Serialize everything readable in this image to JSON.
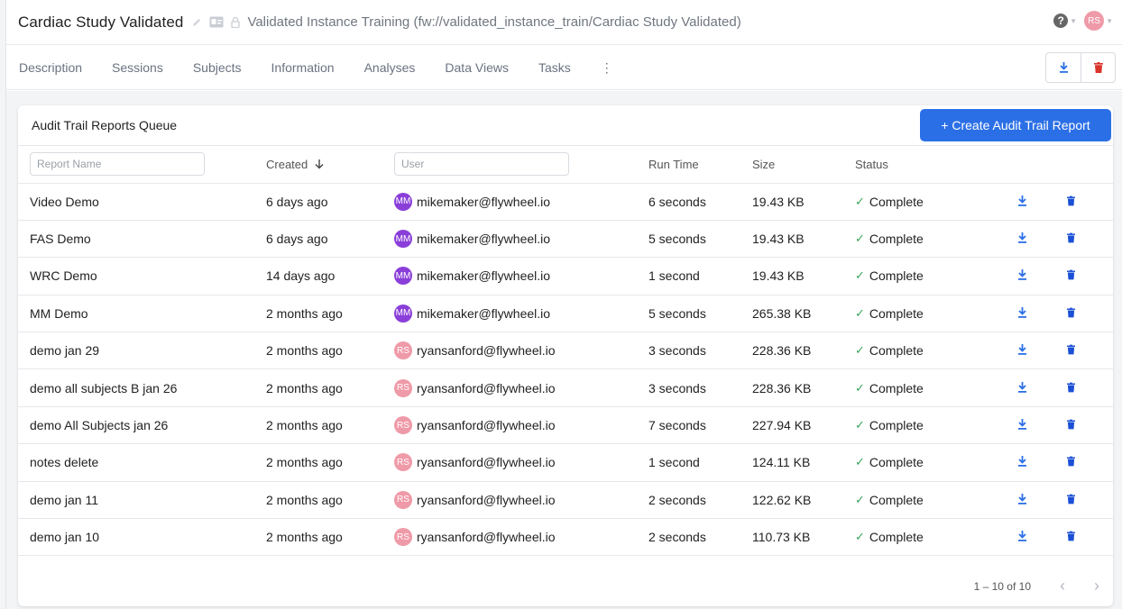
{
  "header": {
    "title": "Cardiac Study Validated",
    "path": "Validated Instance Training (fw://validated_instance_train/Cardiac Study Validated)",
    "help_icon": "?",
    "user_initials": "RS"
  },
  "tabs": [
    {
      "label": "Description"
    },
    {
      "label": "Sessions"
    },
    {
      "label": "Subjects"
    },
    {
      "label": "Information"
    },
    {
      "label": "Analyses"
    },
    {
      "label": "Data Views"
    },
    {
      "label": "Tasks"
    }
  ],
  "card": {
    "title": "Audit Trail Reports Queue",
    "create_label": "+ Create Audit Trail Report"
  },
  "table": {
    "report_placeholder": "Report Name",
    "user_placeholder": "User",
    "col_created": "Created",
    "col_runtime": "Run Time",
    "col_size": "Size",
    "col_status": "Status",
    "rows": [
      {
        "name": "Video Demo",
        "created": "6 days ago",
        "initials": "MM",
        "avatar_color": "#8a3fd9",
        "user": "mikemaker@flywheel.io",
        "runtime": "6 seconds",
        "size": "19.43 KB",
        "status": "Complete"
      },
      {
        "name": "FAS Demo",
        "created": "6 days ago",
        "initials": "MM",
        "avatar_color": "#8a3fd9",
        "user": "mikemaker@flywheel.io",
        "runtime": "5 seconds",
        "size": "19.43 KB",
        "status": "Complete"
      },
      {
        "name": "WRC Demo",
        "created": "14 days ago",
        "initials": "MM",
        "avatar_color": "#8a3fd9",
        "user": "mikemaker@flywheel.io",
        "runtime": "1 second",
        "size": "19.43 KB",
        "status": "Complete"
      },
      {
        "name": "MM Demo",
        "created": "2 months ago",
        "initials": "MM",
        "avatar_color": "#8a3fd9",
        "user": "mikemaker@flywheel.io",
        "runtime": "5 seconds",
        "size": "265.38 KB",
        "status": "Complete"
      },
      {
        "name": "demo jan 29",
        "created": "2 months ago",
        "initials": "RS",
        "avatar_color": "#ef9aa8",
        "user": "ryansanford@flywheel.io",
        "runtime": "3 seconds",
        "size": "228.36 KB",
        "status": "Complete"
      },
      {
        "name": "demo all subjects B jan 26",
        "created": "2 months ago",
        "initials": "RS",
        "avatar_color": "#ef9aa8",
        "user": "ryansanford@flywheel.io",
        "runtime": "3 seconds",
        "size": "228.36 KB",
        "status": "Complete"
      },
      {
        "name": "demo All Subjects jan 26",
        "created": "2 months ago",
        "initials": "RS",
        "avatar_color": "#ef9aa8",
        "user": "ryansanford@flywheel.io",
        "runtime": "7 seconds",
        "size": "227.94 KB",
        "status": "Complete"
      },
      {
        "name": "notes delete",
        "created": "2 months ago",
        "initials": "RS",
        "avatar_color": "#ef9aa8",
        "user": "ryansanford@flywheel.io",
        "runtime": "1 second",
        "size": "124.11 KB",
        "status": "Complete"
      },
      {
        "name": "demo jan 11",
        "created": "2 months ago",
        "initials": "RS",
        "avatar_color": "#ef9aa8",
        "user": "ryansanford@flywheel.io",
        "runtime": "2 seconds",
        "size": "122.62 KB",
        "status": "Complete"
      },
      {
        "name": "demo jan 10",
        "created": "2 months ago",
        "initials": "RS",
        "avatar_color": "#ef9aa8",
        "user": "ryansanford@flywheel.io",
        "runtime": "2 seconds",
        "size": "110.73 KB",
        "status": "Complete"
      }
    ]
  },
  "pagination": {
    "range": "1 – 10 of 10"
  },
  "colors": {
    "accent": "#2b6fe6",
    "delete": "#d9342b",
    "success": "#3aa55a"
  },
  "icons": [
    "pencil-icon",
    "id-card-icon",
    "lock-icon",
    "help-icon",
    "chevron-down-icon",
    "more-vertical-icon",
    "download-icon",
    "trash-icon",
    "sort-down-icon",
    "check-icon",
    "chevron-left-icon",
    "chevron-right-icon"
  ]
}
